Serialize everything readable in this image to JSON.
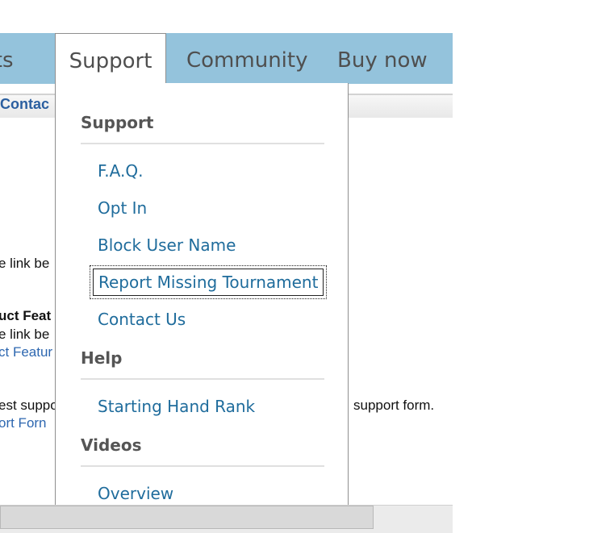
{
  "nav": {
    "products_label": "ucts",
    "support_label": "Support",
    "community_label": "Community",
    "buynow_label": "Buy now"
  },
  "subbar": {
    "text": "Contac"
  },
  "page": {
    "line1": "e link be",
    "feature_title": "uct Feat",
    "line2": "e link be",
    "feature_link": "ct Featur",
    "line3": "est suppo",
    "support_form_text": "support form.",
    "support_form_link": "ort Forn"
  },
  "dropdown": {
    "sections": [
      {
        "heading": "Support",
        "items": [
          "F.A.Q.",
          "Opt In",
          "Block User Name",
          "Report Missing Tournament",
          "Contact Us"
        ]
      },
      {
        "heading": "Help",
        "items": [
          "Starting Hand Rank"
        ]
      },
      {
        "heading": "Videos",
        "items": [
          "Overview"
        ]
      }
    ]
  }
}
